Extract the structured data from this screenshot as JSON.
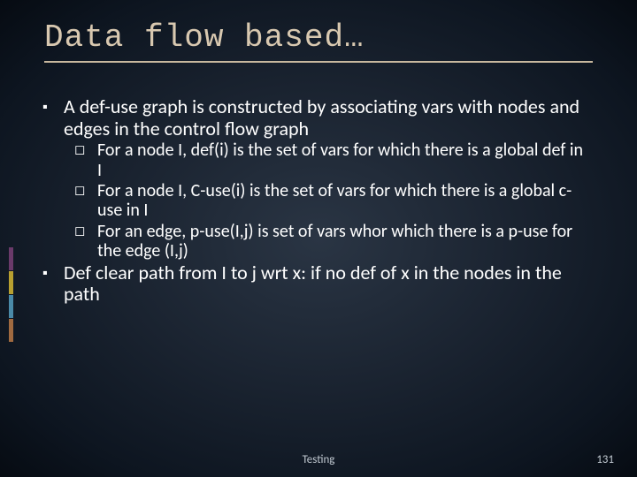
{
  "title": "Data flow based…",
  "bullets": {
    "b1": "A def-use graph is constructed by associating vars with nodes and edges in the control flow graph",
    "b1_sub": {
      "s1": "For a node I, def(i) is the set of vars for which there is a global def in I",
      "s2": "For a node I, C-use(i) is the set of vars for which there is a global c-use in I",
      "s3": "For an edge, p-use(I,j) is set of vars whor which there is a p-use for the edge (I,j)"
    },
    "b2": "Def clear path from I to j wrt x: if no def of x in the nodes in the path"
  },
  "footer": {
    "label": "Testing",
    "page": "131"
  },
  "glyphs": {
    "square": "▪",
    "open_square": "◻"
  }
}
